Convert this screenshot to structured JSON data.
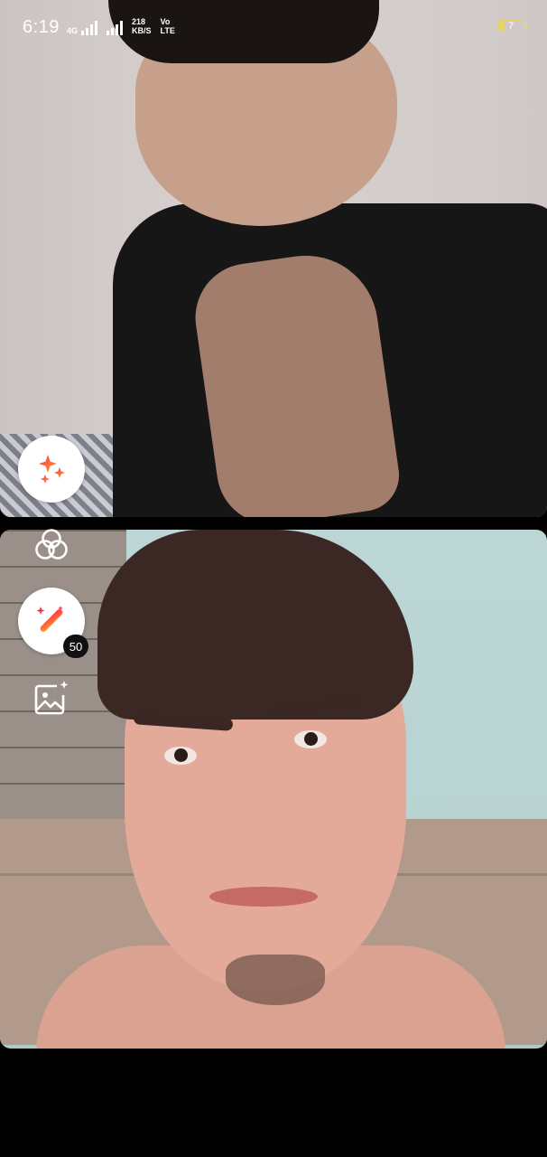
{
  "status_bar": {
    "time": "6:19",
    "network_top": "4G",
    "data_rate_value": "218",
    "data_rate_unit": "KB/S",
    "volte_top": "Vo",
    "volte_bottom": "LTE",
    "battery_level": "7"
  },
  "controls": {
    "effects_icon": "sparkles-icon",
    "filters_icon": "overlapping-circles-icon",
    "beauty_icon": "magic-wand-icon",
    "beauty_count": "50",
    "gallery_icon": "image-sparkle-icon"
  },
  "colors": {
    "accent_gradient_start": "#ff2d55",
    "accent_gradient_end": "#ff9f1c",
    "battery": "#e5d66a"
  }
}
